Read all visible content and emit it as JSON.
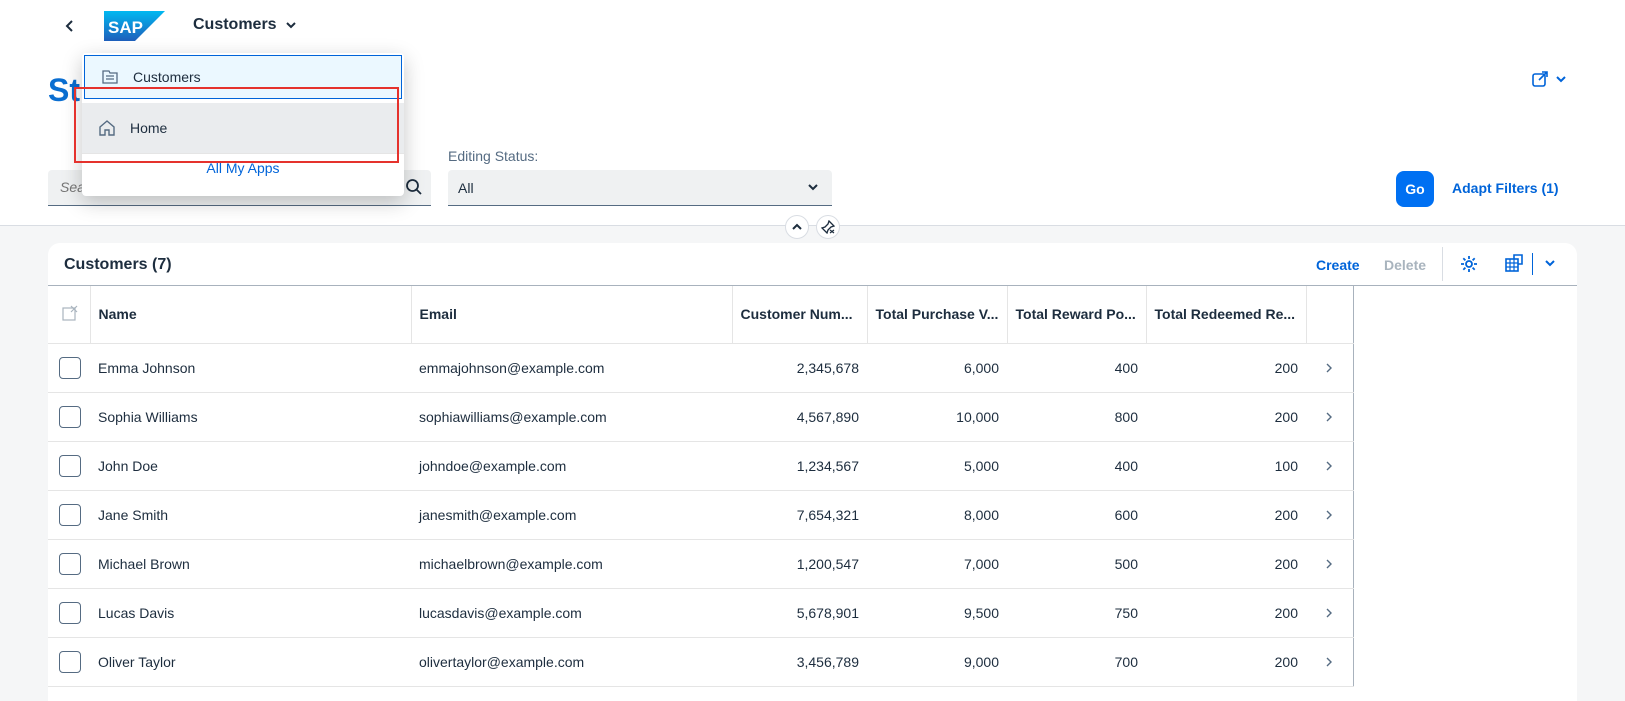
{
  "shell": {
    "app_title": "Customers",
    "logo_text": "SAP"
  },
  "page": {
    "title": "St",
    "editing_status_label": "Editing Status:",
    "search_placeholder": "Search",
    "editing_status_value": "All",
    "go_label": "Go",
    "adapt_filters_label": "Adapt Filters (1)"
  },
  "table": {
    "title": "Customers (7)",
    "create_label": "Create",
    "delete_label": "Delete",
    "columns": [
      "Name",
      "Email",
      "Customer Num...",
      "Total Purchase V...",
      "Total Reward Po...",
      "Total Redeemed Re..."
    ],
    "rows": [
      {
        "name": "Emma Johnson",
        "email": "emmajohnson@example.com",
        "customer_number": "2,345,678",
        "total_purchase": "6,000",
        "reward_points": "400",
        "redeemed": "200"
      },
      {
        "name": "Sophia Williams",
        "email": "sophiawilliams@example.com",
        "customer_number": "4,567,890",
        "total_purchase": "10,000",
        "reward_points": "800",
        "redeemed": "200"
      },
      {
        "name": "John Doe",
        "email": "johndoe@example.com",
        "customer_number": "1,234,567",
        "total_purchase": "5,000",
        "reward_points": "400",
        "redeemed": "100"
      },
      {
        "name": "Jane Smith",
        "email": "janesmith@example.com",
        "customer_number": "7,654,321",
        "total_purchase": "8,000",
        "reward_points": "600",
        "redeemed": "200"
      },
      {
        "name": "Michael Brown",
        "email": "michaelbrown@example.com",
        "customer_number": "1,200,547",
        "total_purchase": "7,000",
        "reward_points": "500",
        "redeemed": "200"
      },
      {
        "name": "Lucas Davis",
        "email": "lucasdavis@example.com",
        "customer_number": "5,678,901",
        "total_purchase": "9,500",
        "reward_points": "750",
        "redeemed": "200"
      },
      {
        "name": "Oliver Taylor",
        "email": "olivertaylor@example.com",
        "customer_number": "3,456,789",
        "total_purchase": "9,000",
        "reward_points": "700",
        "redeemed": "200"
      }
    ]
  },
  "popover": {
    "items": [
      {
        "label": "Customers",
        "icon": "list-icon"
      },
      {
        "label": "Home",
        "icon": "home-icon"
      }
    ],
    "all_apps_label": "All My Apps"
  },
  "colors": {
    "brand": "#0070f2",
    "link": "#0064d9",
    "highlight": "#e5322d"
  }
}
